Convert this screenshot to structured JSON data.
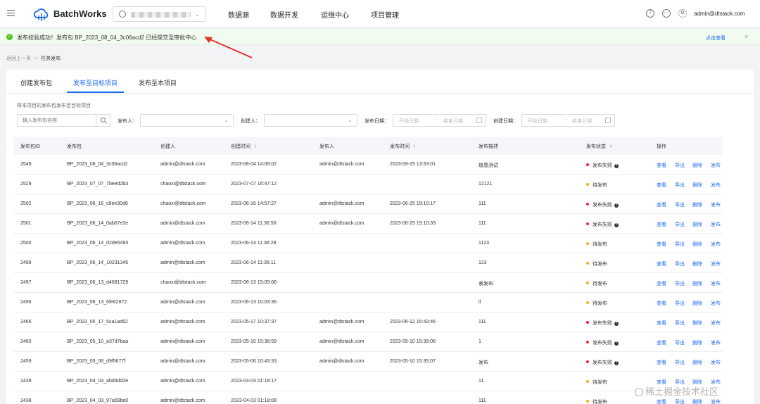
{
  "header": {
    "brand": "BatchWorks",
    "nav": [
      "数据源",
      "数据开发",
      "运维中心",
      "项目管理"
    ],
    "user_email": "admin@dtstack.com",
    "icons": [
      "help-icon",
      "message-icon",
      "settings-icon"
    ]
  },
  "alert": {
    "text": "发布校验成功！发布包 BP_2023_08_04_3c06acd2 已经提交至审批中心",
    "link": "点击查看",
    "close": "×"
  },
  "breadcrumb": {
    "back": "返回上一页",
    "separator": ">",
    "current": "任务发布"
  },
  "tabs": [
    "创建发布包",
    "发布至目标项目",
    "发布至本项目"
  ],
  "filters": {
    "section_title": "将本项目的发布包发布至目标项目",
    "search_placeholder": "输入发布包名称",
    "publisher_label": "发布人：",
    "creator_label": "创建人：",
    "publish_date_label": "发布日期：",
    "create_date_label": "创建日期：",
    "start_placeholder": "开始日期",
    "end_placeholder": "结束日期",
    "range_arrow": "→"
  },
  "table": {
    "columns": [
      "发布包ID",
      "发布包",
      "创建人",
      "创建时间",
      "发布人",
      "发布时间",
      "发布描述",
      "发布状态",
      "操作"
    ],
    "actions": [
      "查看",
      "导出",
      "删除",
      "发布"
    ],
    "rows": [
      {
        "id": "2549",
        "pkg": "BP_2023_08_04_3c06acd2",
        "creator": "admin@dtstack.com",
        "created": "2023-08-04 14:09:02",
        "publisher": "admin@dtstack.com",
        "published": "2023-09-25 13:53:01",
        "desc": "琉恩测试",
        "status": "发布失败",
        "status_type": "fail"
      },
      {
        "id": "2529",
        "pkg": "BP_2023_07_07_7beed2b3",
        "creator": "chaoxi@dtstack.com",
        "created": "2023-07-07 16:47:12",
        "publisher": "",
        "published": "",
        "desc": "12121",
        "status": "待发布",
        "status_type": "wait"
      },
      {
        "id": "2502",
        "pkg": "BP_2023_06_16_c8ee30d8",
        "creator": "chaoxi@dtstack.com",
        "created": "2023-06-16 14:57:27",
        "publisher": "admin@dtstack.com",
        "published": "2023-06-25 19:10:17",
        "desc": "111",
        "status": "发布失败",
        "status_type": "fail"
      },
      {
        "id": "2501",
        "pkg": "BP_2023_06_14_0ab67e2e",
        "creator": "admin@dtstack.com",
        "created": "2023-06-14 11:36:50",
        "publisher": "admin@dtstack.com",
        "published": "2023-06-25 19:10:33",
        "desc": "111",
        "status": "发布失败",
        "status_type": "fail"
      },
      {
        "id": "2500",
        "pkg": "BP_2023_06_14_d2de5493",
        "creator": "admin@dtstack.com",
        "created": "2023-06-14 11:36:28",
        "publisher": "",
        "published": "",
        "desc": "1123",
        "status": "待发布",
        "status_type": "wait"
      },
      {
        "id": "2499",
        "pkg": "BP_2023_06_14_10231345",
        "creator": "admin@dtstack.com",
        "created": "2023-06-14 11:36:11",
        "publisher": "",
        "published": "",
        "desc": "123",
        "status": "待发布",
        "status_type": "wait"
      },
      {
        "id": "2497",
        "pkg": "BP_2023_06_13_d4681729",
        "creator": "chaoxi@dtstack.com",
        "created": "2023-06-13 15:09:08",
        "publisher": "",
        "published": "",
        "desc": "表发布",
        "status": "待发布",
        "status_type": "wait"
      },
      {
        "id": "2496",
        "pkg": "BP_2023_06_13_6fe62872",
        "creator": "admin@dtstack.com",
        "created": "2023-06-13 10:03:36",
        "publisher": "",
        "published": "",
        "desc": "ll",
        "status": "待发布",
        "status_type": "wait"
      },
      {
        "id": "2466",
        "pkg": "BP_2023_05_17_5ca1ad62",
        "creator": "admin@dtstack.com",
        "created": "2023-05-17 10:37:37",
        "publisher": "admin@dtstack.com",
        "published": "2023-06-12 16:43:46",
        "desc": "111",
        "status": "发布失败",
        "status_type": "fail"
      },
      {
        "id": "2460",
        "pkg": "BP_2023_05_10_a37d7baa",
        "creator": "admin@dtstack.com",
        "created": "2023-05-10 15:38:59",
        "publisher": "admin@dtstack.com",
        "published": "2023-05-10 15:39:06",
        "desc": "1",
        "status": "发布失败",
        "status_type": "fail"
      },
      {
        "id": "2459",
        "pkg": "BP_2023_05_06_d9f5677f",
        "creator": "admin@dtstack.com",
        "created": "2023-05-06 10:43:33",
        "publisher": "admin@dtstack.com",
        "published": "2023-05-10 15:35:07",
        "desc": "发布",
        "status": "发布失败",
        "status_type": "fail"
      },
      {
        "id": "2439",
        "pkg": "BP_2023_04_03_abd4dd2e",
        "creator": "admin@dtstack.com",
        "created": "2023-04-03 01:18:17",
        "publisher": "",
        "published": "",
        "desc": "11",
        "status": "待发布",
        "status_type": "wait"
      },
      {
        "id": "2438",
        "pkg": "BP_2023_04_03_97a59be0",
        "creator": "admin@dtstack.com",
        "created": "2023-04-03 01:18:08",
        "publisher": "",
        "published": "",
        "desc": "111",
        "status": "待发布",
        "status_type": "wait"
      }
    ]
  },
  "watermark": "稀土掘金技术社区",
  "colors": {
    "primary": "#1b6af2",
    "success": "#52c41a",
    "fail": "#f5222d",
    "wait": "#faad14",
    "annotation": "#e0332a"
  }
}
